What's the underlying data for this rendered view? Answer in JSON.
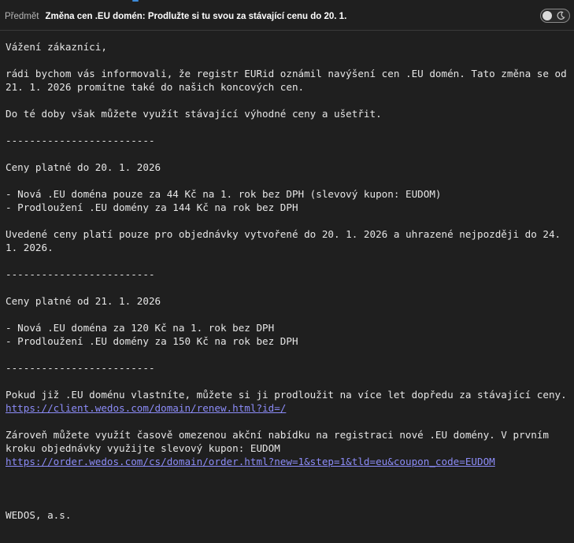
{
  "header": {
    "subject_label": "Předmět",
    "subject": "Změna cen .EU domén: Prodlužte si tu svou za stávající cenu do 20. 1.",
    "theme_toggle_icon": "moon-icon"
  },
  "email": {
    "greeting": "Vážení zákazníci,",
    "intro": "rádi bychom vás informovali, že registr EURid oznámil navýšení cen .EU domén. Tato změna se od 21. 1. 2026 promítne také do našich koncových cen.",
    "before": "Do té doby však můžete využít stávající výhodné ceny a ušetřit.",
    "separator": "-------------------------",
    "current_heading": "Ceny platné do 20. 1. 2026",
    "current_item_1": "- Nová .EU doména pouze za 44 Kč na 1. rok bez DPH (slevový kupon: EUDOM)",
    "current_item_2": "- Prodloužení .EU domény za 144 Kč na rok bez DPH",
    "validity_note": "Uvedené ceny platí pouze pro objednávky vytvořené do 20. 1. 2026 a uhrazené nejpozději do 24. 1. 2026.",
    "new_heading": "Ceny platné od 21. 1. 2026",
    "new_item_1": "- Nová .EU doména za 120 Kč na 1. rok bez DPH",
    "new_item_2": "- Prodloužení .EU domény za 150 Kč na rok bez DPH",
    "renew_text": "Pokud již .EU doménu vlastníte, můžete si ji prodloužit na více let dopředu za stávající ceny.",
    "renew_link": "https://client.wedos.com/domain/renew.html?id=/",
    "offer_text": "Zároveň můžete využít časově omezenou akční nabídku na registraci nové .EU domény. V prvním kroku objednávky využijte slevový kupon: EUDOM",
    "offer_link": "https://order.wedos.com/cs/domain/order.html?new=1&step=1&tld=eu&coupon_code=EUDOM",
    "signature": "WEDOS, a.s."
  }
}
